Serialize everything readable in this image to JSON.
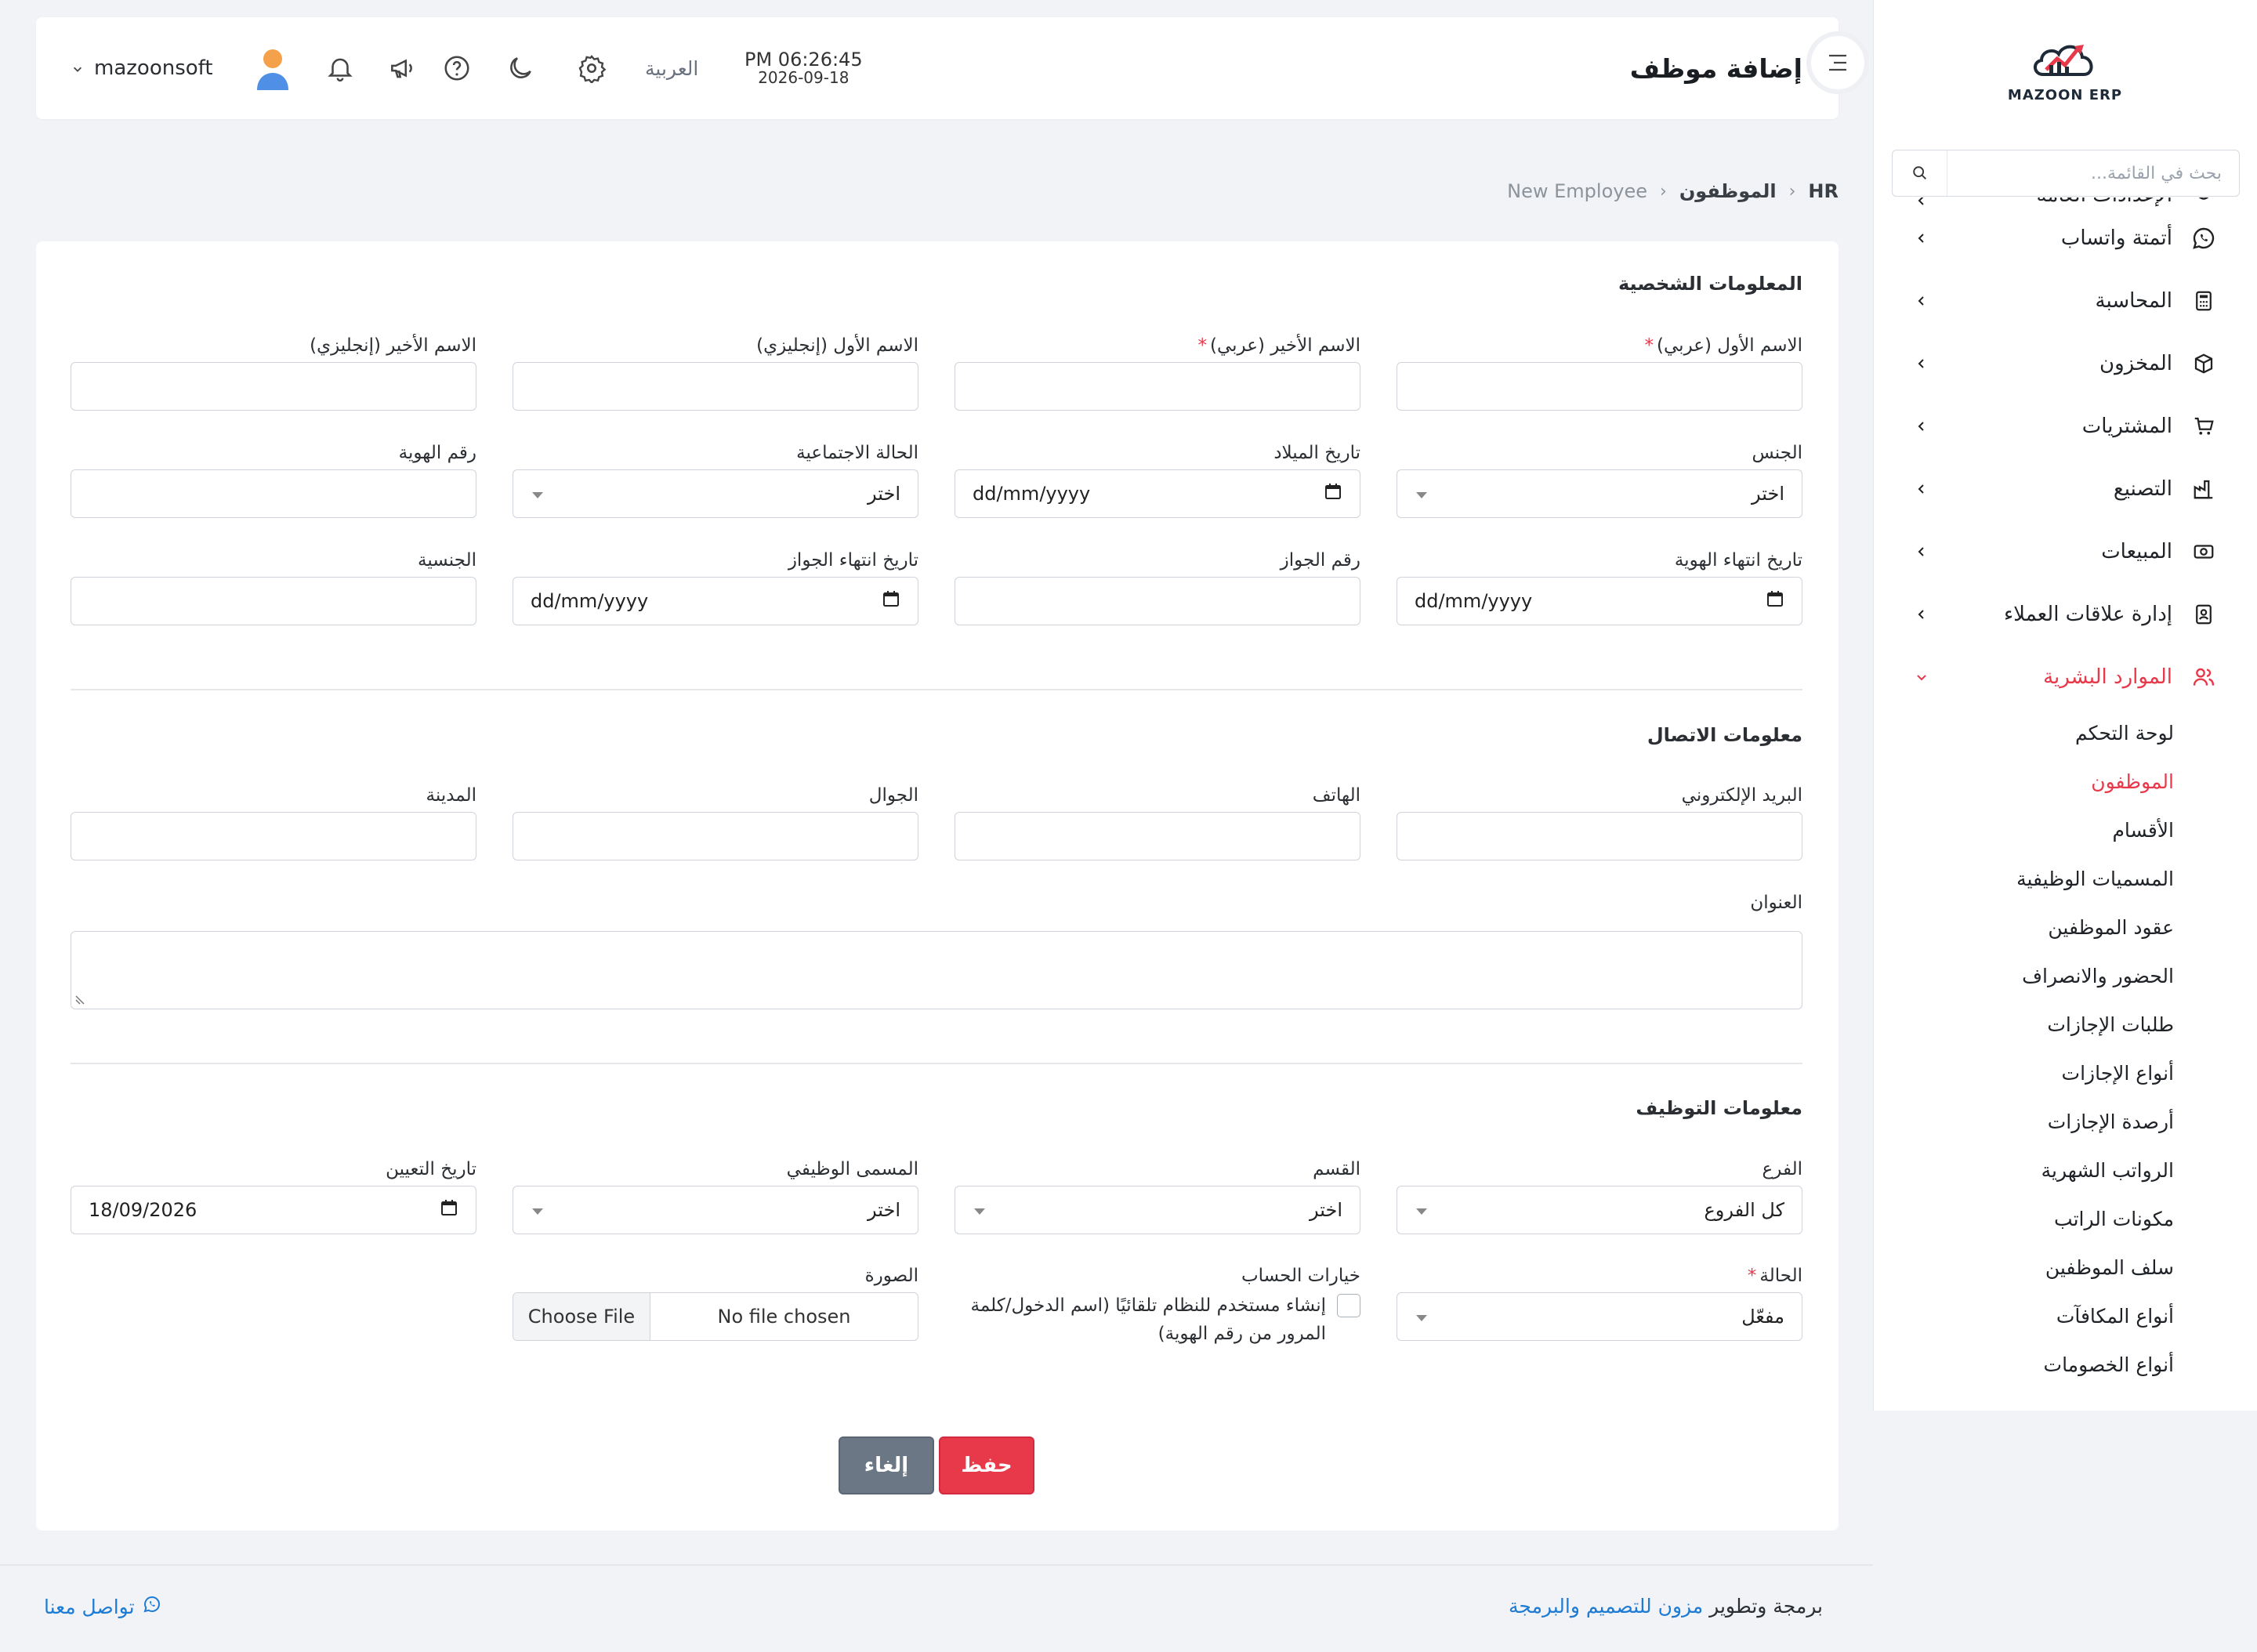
{
  "sidebar": {
    "brand": "MAZOON ERP",
    "search_placeholder": "بحث في القائمة...",
    "partial_item": "الإعدادات العامة",
    "items": [
      {
        "label": "أتمتة واتساب",
        "icon": "whatsapp-icon"
      },
      {
        "label": "المحاسبة",
        "icon": "calculator-icon"
      },
      {
        "label": "المخزون",
        "icon": "box-icon"
      },
      {
        "label": "المشتريات",
        "icon": "cart-icon"
      },
      {
        "label": "التصنيع",
        "icon": "factory-icon"
      },
      {
        "label": "المبيعات",
        "icon": "money-icon"
      },
      {
        "label": "إدارة علاقات العملاء",
        "icon": "contacts-icon"
      }
    ],
    "active_item": {
      "label": "الموارد البشرية",
      "icon": "users-icon"
    },
    "submenu": [
      "لوحة التحكم",
      "الموظفون",
      "الأقسام",
      "المسميات الوظيفية",
      "عقود الموظفين",
      "الحضور والانصراف",
      "طلبات الإجازات",
      "أنواع الإجازات",
      "أرصدة الإجازات",
      "الرواتب الشهرية",
      "مكونات الراتب",
      "سلف الموظفين",
      "أنواع المكافآت",
      "أنواع الخصومات"
    ],
    "active_submenu": "الموظفون",
    "accent": "#e8394a"
  },
  "topbar": {
    "title": "إضافة موظف",
    "time": "PM 06:26:45",
    "date": "2026-09-18",
    "language": "العربية",
    "username": "mazoonsoft"
  },
  "breadcrumb": {
    "root": "HR",
    "section": "الموظفون",
    "current": "New Employee"
  },
  "personal": {
    "title": "المعلومات الشخصية",
    "first_name_ar": "الاسم الأول (عربي)",
    "last_name_ar": "الاسم الأخير (عربي)",
    "first_name_en": "الاسم الأول (إنجليزي)",
    "last_name_en": "الاسم الأخير (إنجليزي)",
    "gender": "الجنس",
    "gender_value": "اختر",
    "birth_date": "تاريخ الميلاد",
    "birth_date_value": "dd/mm/yyyy",
    "marital": "الحالة الاجتماعية",
    "marital_value": "اختر",
    "id_number": "رقم الهوية",
    "id_expiry": "تاريخ انتهاء الهوية",
    "id_expiry_value": "dd/mm/yyyy",
    "passport": "رقم الجواز",
    "passport_expiry": "تاريخ انتهاء الجواز",
    "passport_expiry_value": "dd/mm/yyyy",
    "nationality": "الجنسية"
  },
  "contact": {
    "title": "معلومات الاتصال",
    "email": "البريد الإلكتروني",
    "phone": "الهاتف",
    "mobile": "الجوال",
    "city": "المدينة",
    "address": "العنوان"
  },
  "employment": {
    "title": "معلومات التوظيف",
    "branch": "الفرع",
    "branch_value": "كل الفروع",
    "department": "القسم",
    "department_value": "اختر",
    "job_title": "المسمى الوظيفي",
    "job_title_value": "اختر",
    "hire_date": "تاريخ التعيين",
    "hire_date_value": "18/09/2026",
    "status": "الحالة",
    "status_value": "مفعّل",
    "account_options": "خيارات الحساب",
    "account_checkbox": "إنشاء مستخدم للنظام تلقائيًا (اسم الدخول/كلمة المرور من رقم الهوية)",
    "photo": "الصورة",
    "choose_file": "Choose File",
    "no_file": "No file chosen"
  },
  "actions": {
    "save": "حفظ",
    "cancel": "إلغاء"
  },
  "footer": {
    "credit_prefix": "برمجة وتطوير",
    "credit_link": "مزون للتصميم والبرمجة",
    "contact": "تواصل معنا"
  }
}
